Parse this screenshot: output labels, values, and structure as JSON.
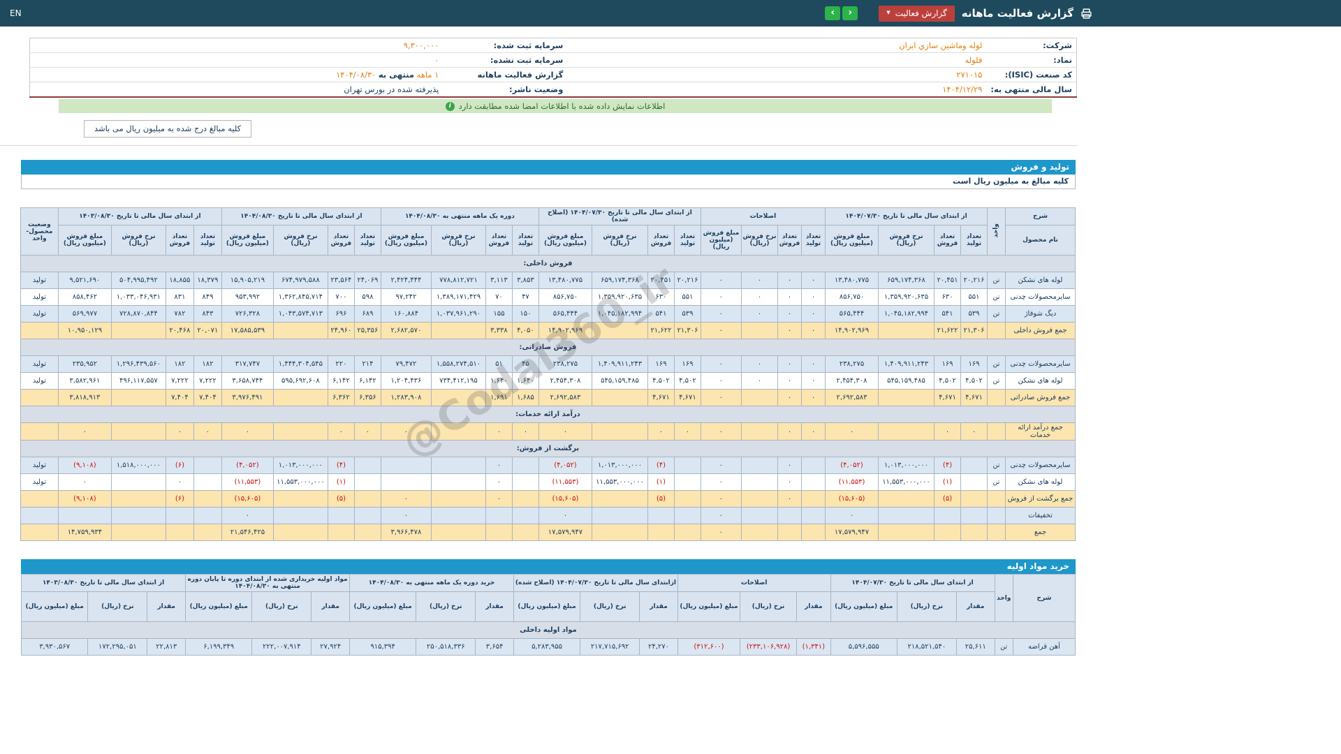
{
  "colors": {
    "topbar": "#1f4a5e",
    "accent_blue": "#1e97cb",
    "button_red": "#bb403c",
    "button_green": "#2cb34a",
    "value_orange": "#e5800e",
    "total_row": "#fce5ae",
    "zebra_row": "#dbe6f3",
    "banner_green": "#cfe7c3",
    "maroon_line": "#8f3838",
    "negative": "#cc1111"
  },
  "topbar": {
    "title": "گزارش فعالیت ماهانه",
    "report_button": "گزارش فعالیت",
    "caret_glyph": "▼",
    "prev_glyph": "‹",
    "next_glyph": "›",
    "lang": "EN",
    "printer_icon": "printer-icon"
  },
  "info": {
    "rows": [
      {
        "label_r": "شرکت:",
        "value_r": "لوله وماشين سازي ايران",
        "label_l": "سرمایه ثبت شده:",
        "value_l": "۹,۳۰۰,۰۰۰"
      },
      {
        "label_r": "نماد:",
        "value_r": "قلوله",
        "label_l": "سرمایه ثبت نشده:",
        "value_l": "۰"
      },
      {
        "label_r": "کد صنعت (ISIC):",
        "value_r": "۲۷۱۰۱۵",
        "label_l": "گزارش فعالیت ماهانه"
      },
      {
        "label_r": "سال مالی منتهی به:",
        "value_r": "۱۴۰۴/۱۲/۲۹",
        "label_l": "وضعیت ناشر:",
        "value_l": "پذیرفته شده در بورس تهران"
      }
    ],
    "report": {
      "period": "۱ ماهه",
      "infix": "منتهی به",
      "date": "۱۴۰۴/۰۸/۳۰"
    },
    "banner": "اطلاعات نمایش داده شده با اطلاعات امضا شده مطابقت دارد",
    "note_tab": "کلیه مبالغ درج شده به میلیون ریال می باشد"
  },
  "sales": {
    "section_title": "تولید و فروش",
    "subtitle": "کلیه مبالغ به میلیون ریال است",
    "col_desc": "شرح",
    "col_product": "نام محصول",
    "col_unit": "واحد",
    "col_status": "وضعیت محصول-واحد",
    "groups": [
      "از ابتدای سال مالی تا تاریخ ۱۴۰۴/۰۷/۳۰",
      "اصلاحات",
      "از ابتدای سال مالی تا تاریخ ۱۴۰۴/۰۷/۳۰ (اصلاح شده)",
      "دوره یک ماهه منتهی به ۱۴۰۴/۰۸/۳۰",
      "از ابتدای سال مالی تا تاریخ ۱۴۰۴/۰۸/۳۰",
      "از ابتدای سال مالی تا تاریخ ۱۴۰۳/۰۸/۳۰"
    ],
    "subcols": [
      "تعداد تولید",
      "تعداد فروش",
      "نرخ فروش (ریال)",
      "مبلغ فروش (میلیون ریال)"
    ],
    "rows": [
      {
        "type": "section",
        "label": "فروش داخلی:"
      },
      {
        "type": "data",
        "name": "لوله های نشکن",
        "unit": "تن",
        "status": "تولید",
        "g": [
          [
            "۲۰,۲۱۶",
            "۲۰,۴۵۱",
            "۶۵۹,۱۷۴,۳۶۸",
            "۱۳,۴۸۰,۷۷۵"
          ],
          [
            "۰",
            "۰",
            "۰",
            "۰"
          ],
          [
            "۲۰,۲۱۶",
            "۲۰,۴۵۱",
            "۶۵۹,۱۷۴,۳۶۸",
            "۱۳,۴۸۰,۷۷۵"
          ],
          [
            "۳,۸۵۳",
            "۳,۱۱۳",
            "۷۷۸,۸۱۲,۷۲۱",
            "۲,۴۲۴,۴۴۴"
          ],
          [
            "۲۴,۰۶۹",
            "۲۳,۵۶۴",
            "۶۷۴,۹۷۹,۵۸۸",
            "۱۵,۹۰۵,۲۱۹"
          ],
          [
            "۱۸,۳۷۹",
            "۱۸,۸۵۵",
            "۵۰۴,۹۹۵,۴۹۲",
            "۹,۵۲۱,۶۹۰"
          ]
        ]
      },
      {
        "type": "data",
        "name": "سایرمحصولات چدنی",
        "unit": "تن",
        "status": "تولید",
        "g": [
          [
            "۵۵۱",
            "۶۳۰",
            "۱,۳۵۹,۹۲۰,۶۳۵",
            "۸۵۶,۷۵۰"
          ],
          [
            "۰",
            "۰",
            "۰",
            "۰"
          ],
          [
            "۵۵۱",
            "۶۳۰",
            "۱,۳۵۹,۹۲۰,۶۳۵",
            "۸۵۶,۷۵۰"
          ],
          [
            "۴۷",
            "۷۰",
            "۱,۳۸۹,۱۷۱,۴۲۹",
            "۹۷,۲۴۲"
          ],
          [
            "۵۹۸",
            "۷۰۰",
            "۱,۳۶۲,۸۴۵,۷۱۴",
            "۹۵۳,۹۹۲"
          ],
          [
            "۸۴۹",
            "۸۳۱",
            "۱,۰۳۳,۰۴۶,۹۳۱",
            "۸۵۸,۴۶۲"
          ]
        ]
      },
      {
        "type": "data",
        "name": "دیگ شوفاژ",
        "unit": "تن",
        "status": "تولید",
        "g": [
          [
            "۵۳۹",
            "۵۴۱",
            "۱,۰۴۵,۱۸۲,۹۹۴",
            "۵۶۵,۴۴۴"
          ],
          [
            "۰",
            "۰",
            "۰",
            "۰"
          ],
          [
            "۵۳۹",
            "۵۴۱",
            "۱,۰۴۵,۱۸۲,۹۹۴",
            "۵۶۵,۴۴۴"
          ],
          [
            "۱۵۰",
            "۱۵۵",
            "۱,۰۳۷,۹۶۱,۲۹۰",
            "۱۶۰,۸۸۴"
          ],
          [
            "۶۸۹",
            "۶۹۶",
            "۱,۰۴۳,۵۷۴,۷۱۳",
            "۷۲۶,۳۲۸"
          ],
          [
            "۸۴۳",
            "۷۸۲",
            "۷۲۸,۸۷۰,۸۴۴",
            "۵۶۹,۹۷۷"
          ]
        ]
      },
      {
        "type": "total",
        "name": "جمع فروش داخلی",
        "g": [
          [
            "۲۱,۳۰۶",
            "۲۱,۶۲۲",
            "",
            "۱۴,۹۰۲,۹۶۹"
          ],
          [
            "۰",
            "۰",
            "",
            "۰"
          ],
          [
            "۲۱,۳۰۶",
            "۲۱,۶۲۲",
            "",
            "۱۴,۹۰۲,۹۶۹"
          ],
          [
            "۴,۰۵۰",
            "۳,۳۳۸",
            "",
            "۲,۶۸۲,۵۷۰"
          ],
          [
            "۲۵,۳۵۶",
            "۲۴,۹۶۰",
            "",
            "۱۷,۵۸۵,۵۳۹"
          ],
          [
            "۲۰,۰۷۱",
            "۲۰,۴۶۸",
            "",
            "۱۰,۹۵۰,۱۲۹"
          ]
        ]
      },
      {
        "type": "section",
        "label": "فروش صادراتی:"
      },
      {
        "type": "data",
        "name": "سایرمحصولات چدنی",
        "unit": "تن",
        "status": "تولید",
        "g": [
          [
            "۱۶۹",
            "۱۶۹",
            "۱,۴۰۹,۹۱۱,۲۴۳",
            "۲۳۸,۲۷۵"
          ],
          [
            "۰",
            "۰",
            "۰",
            "۰"
          ],
          [
            "۱۶۹",
            "۱۶۹",
            "۱,۴۰۹,۹۱۱,۲۴۳",
            "۲۳۸,۲۷۵"
          ],
          [
            "۴۵",
            "۵۱",
            "۱,۵۵۸,۲۷۴,۵۱۰",
            "۷۹,۴۷۲"
          ],
          [
            "۲۱۴",
            "۲۲۰",
            "۱,۴۴۴,۳۰۴,۵۴۵",
            "۳۱۷,۷۴۷"
          ],
          [
            "۱۸۲",
            "۱۸۲",
            "۱,۲۹۶,۴۳۹,۵۶۰",
            "۲۳۵,۹۵۲"
          ]
        ]
      },
      {
        "type": "data",
        "name": "لوله های نشکن",
        "unit": "تن",
        "status": "تولید",
        "g": [
          [
            "۴,۵۰۲",
            "۴,۵۰۲",
            "۵۴۵,۱۵۹,۴۸۵",
            "۲,۴۵۴,۳۰۸"
          ],
          [
            "۰",
            "۰",
            "۰",
            "۰"
          ],
          [
            "۴,۵۰۲",
            "۴,۵۰۲",
            "۵۴۵,۱۵۹,۴۸۵",
            "۲,۴۵۴,۳۰۸"
          ],
          [
            "۱,۶۴۰",
            "۱,۶۴۰",
            "۷۳۴,۴۱۲,۱۹۵",
            "۱,۲۰۴,۴۳۶"
          ],
          [
            "۶,۱۴۲",
            "۶,۱۴۲",
            "۵۹۵,۶۹۲,۶۰۸",
            "۳,۶۵۸,۷۴۴"
          ],
          [
            "۷,۲۲۲",
            "۷,۲۲۲",
            "۴۹۶,۱۱۷,۵۵۷",
            "۳,۵۸۲,۹۶۱"
          ]
        ]
      },
      {
        "type": "total",
        "name": "جمع فروش صادراتی",
        "g": [
          [
            "۴,۶۷۱",
            "۴,۶۷۱",
            "",
            "۲,۶۹۲,۵۸۳"
          ],
          [
            "۰",
            "۰",
            "",
            "۰"
          ],
          [
            "۴,۶۷۱",
            "۴,۶۷۱",
            "",
            "۲,۶۹۲,۵۸۳"
          ],
          [
            "۱,۶۸۵",
            "۱,۶۹۱",
            "",
            "۱,۲۸۳,۹۰۸"
          ],
          [
            "۶,۳۵۶",
            "۶,۳۶۲",
            "",
            "۳,۹۷۶,۴۹۱"
          ],
          [
            "۷,۴۰۴",
            "۷,۴۰۴",
            "",
            "۳,۸۱۸,۹۱۳"
          ]
        ]
      },
      {
        "type": "section",
        "label": "درآمد ارائه خدمات:"
      },
      {
        "type": "total",
        "name": "جمع درآمد ارائه خدمات",
        "g": [
          [
            "۰",
            "۰",
            "",
            "۰"
          ],
          [
            "۰",
            "۰",
            "",
            "۰"
          ],
          [
            "۰",
            "۰",
            "",
            "۰"
          ],
          [
            "۰",
            "۰",
            "",
            "۰"
          ],
          [
            "۰",
            "۰",
            "",
            "۰"
          ],
          [
            "۰",
            "۰",
            "",
            "۰"
          ]
        ]
      },
      {
        "type": "section",
        "label": "برگشت از فروش:"
      },
      {
        "type": "data",
        "name": "سایرمحصولات چدنی",
        "unit": "تن",
        "status": "تولید",
        "g": [
          [
            "",
            "(۴)",
            "۱,۰۱۳,۰۰۰,۰۰۰",
            "(۴,۰۵۲)"
          ],
          [
            "",
            "۰",
            "",
            "۰"
          ],
          [
            "",
            "(۴)",
            "۱,۰۱۳,۰۰۰,۰۰۰",
            "(۴,۰۵۲)"
          ],
          [
            "",
            "۰",
            "",
            ""
          ],
          [
            "",
            "(۴)",
            "۱,۰۱۳,۰۰۰,۰۰۰",
            "(۴,۰۵۲)"
          ],
          [
            "",
            "(۶)",
            "۱,۵۱۸,۰۰۰,۰۰۰",
            "(۹,۱۰۸)"
          ]
        ]
      },
      {
        "type": "data",
        "name": "لوله های نشکن",
        "unit": "تن",
        "status": "تولید",
        "g": [
          [
            "",
            "(۱)",
            "۱۱,۵۵۳,۰۰۰,۰۰۰",
            "(۱۱,۵۵۳)"
          ],
          [
            "",
            "۰",
            "",
            "۰"
          ],
          [
            "",
            "(۱)",
            "۱۱,۵۵۳,۰۰۰,۰۰۰",
            "(۱۱,۵۵۳)"
          ],
          [
            "",
            "۰",
            "",
            ""
          ],
          [
            "",
            "(۱)",
            "۱۱,۵۵۳,۰۰۰,۰۰۰",
            "(۱۱,۵۵۳)"
          ],
          [
            "",
            "۰",
            "",
            "۰"
          ]
        ]
      },
      {
        "type": "total",
        "name": "جمع برگشت از فروش",
        "g": [
          [
            "",
            "(۵)",
            "",
            "(۱۵,۶۰۵)"
          ],
          [
            "",
            "۰",
            "",
            "۰"
          ],
          [
            "",
            "(۵)",
            "",
            "(۱۵,۶۰۵)"
          ],
          [
            "",
            "۰",
            "",
            "۰"
          ],
          [
            "",
            "(۵)",
            "",
            "(۱۵,۶۰۵)"
          ],
          [
            "",
            "(۶)",
            "",
            "(۹,۱۰۸)"
          ]
        ]
      },
      {
        "type": "data",
        "name": "تخفیفات",
        "unit": "",
        "status": "",
        "g": [
          [
            "",
            "",
            "",
            "۰"
          ],
          [
            "",
            "",
            "",
            "۰"
          ],
          [
            "",
            "",
            "",
            "۰"
          ],
          [
            "",
            "",
            "",
            "۰"
          ],
          [
            "",
            "",
            "",
            "۰"
          ],
          [
            "",
            "",
            "",
            ""
          ]
        ]
      },
      {
        "type": "total",
        "name": "جمع",
        "g": [
          [
            "",
            "",
            "",
            "۱۷,۵۷۹,۹۴۷"
          ],
          [
            "",
            "",
            "",
            "۰"
          ],
          [
            "",
            "",
            "",
            "۱۷,۵۷۹,۹۴۷"
          ],
          [
            "",
            "",
            "",
            "۳,۹۶۶,۴۷۸"
          ],
          [
            "",
            "",
            "",
            "۲۱,۵۴۶,۴۲۵"
          ],
          [
            "",
            "",
            "",
            "۱۴,۷۵۹,۹۳۴"
          ]
        ]
      }
    ]
  },
  "purchases": {
    "section_title": "خرید مواد اولیه",
    "col_desc": "شرح",
    "col_unit": "واحد",
    "groups": [
      "از ابتدای سال مالی تا تاریخ ۱۴۰۴/۰۷/۳۰",
      "اصلاحات",
      "ازابتدای سال مالی تا تاریخ ۱۴۰۴/۰۷/۳۰ (اصلاح شده)",
      "خرید دوره یک ماهه منتهی به ۱۴۰۴/۰۸/۳۰",
      "مواد اولیه خریداری شده از ابتدای دوره تا پایان دوره منتهی به ۱۴۰۴/۰۸/۳۰",
      "از ابتدای سال مالی تا تاریخ ۱۴۰۳/۰۸/۳۰"
    ],
    "subcols": [
      "مقدار",
      "نرخ (ریال)",
      "مبلغ (میلیون ریال)"
    ],
    "rows": [
      {
        "type": "section",
        "label": "مواد اولیه داخلی"
      },
      {
        "type": "data",
        "name": "آهن قراضه",
        "unit": "تن",
        "g": [
          [
            "۲۵,۶۱۱",
            "۲۱۸,۵۲۱,۵۴۰",
            "۵,۵۹۶,۵۵۵"
          ],
          [
            "(۱,۳۴۱)",
            "(۲۳۳,۱۰۶,۹۲۸)",
            "(۳۱۲,۶۰۰)"
          ],
          [
            "۲۴,۲۷۰",
            "۲۱۷,۷۱۵,۶۹۲",
            "۵,۲۸۳,۹۵۵"
          ],
          [
            "۳,۶۵۴",
            "۲۵۰,۵۱۸,۳۳۶",
            "۹۱۵,۳۹۴"
          ],
          [
            "۲۷,۹۲۴",
            "۲۲۲,۰۰۷,۹۱۴",
            "۶,۱۹۹,۳۴۹"
          ],
          [
            "۲۲,۸۱۳",
            "۱۷۲,۲۹۵,۰۵۱",
            "۳,۹۳۰,۵۶۷"
          ]
        ]
      }
    ]
  },
  "watermark": "@Codal360_ir"
}
